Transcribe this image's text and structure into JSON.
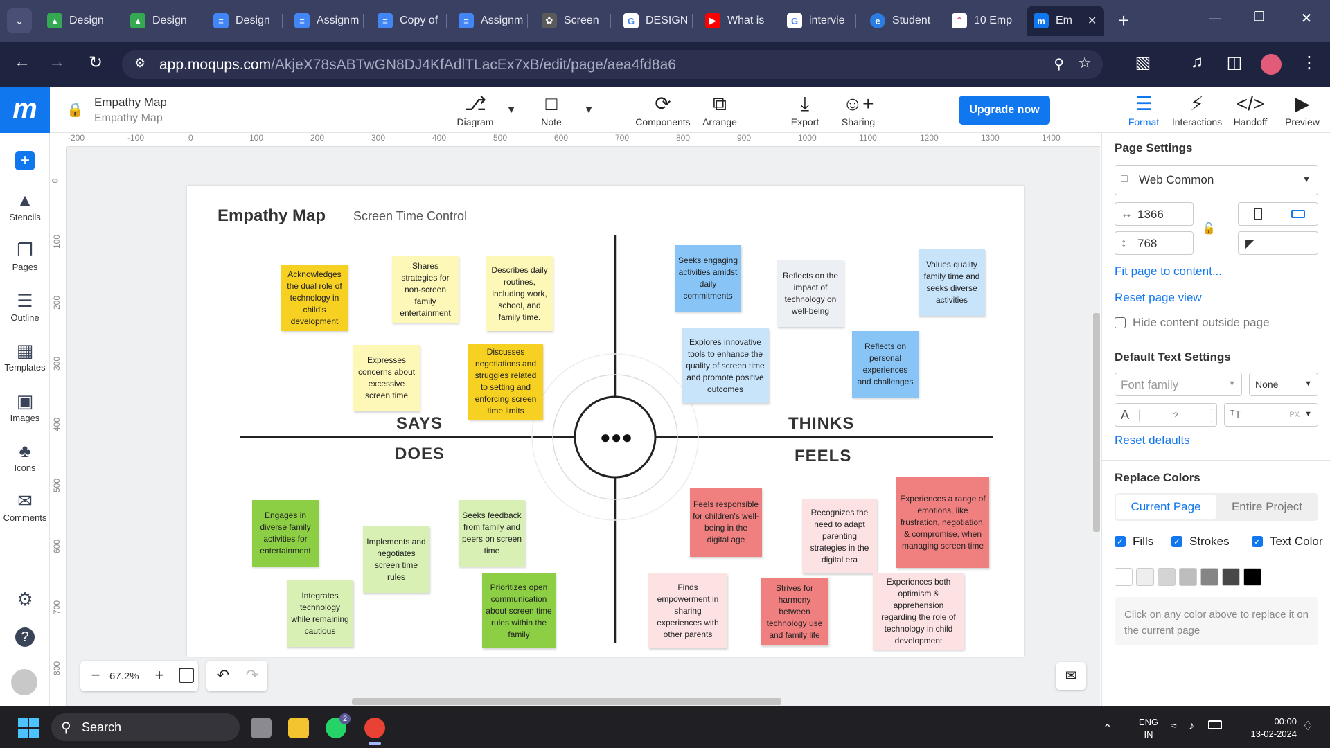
{
  "browser": {
    "tabs": [
      {
        "label": "Design",
        "icon": "google-drive-icon",
        "color": "#34a853"
      },
      {
        "label": "Design",
        "icon": "google-drive-icon",
        "color": "#34a853"
      },
      {
        "label": "Design",
        "icon": "google-docs-icon",
        "color": "#4285f4"
      },
      {
        "label": "Assignm",
        "icon": "google-docs-icon",
        "color": "#4285f4"
      },
      {
        "label": "Copy of",
        "icon": "google-docs-icon",
        "color": "#4285f4"
      },
      {
        "label": "Assignm",
        "icon": "google-docs-icon",
        "color": "#4285f4"
      },
      {
        "label": "Screen",
        "icon": "chatgpt-icon",
        "color": "#5a5a5a"
      },
      {
        "label": "DESIGN",
        "icon": "google-icon",
        "color": "#ffffff"
      },
      {
        "label": "What is",
        "icon": "youtube-icon",
        "color": "#ff0000"
      },
      {
        "label": "intervie",
        "icon": "google-icon",
        "color": "#ffffff"
      },
      {
        "label": "Student",
        "icon": "edge-icon",
        "color": "#2a7de1"
      },
      {
        "label": "10 Emp",
        "icon": "clickup-icon",
        "color": "#e84393"
      },
      {
        "label": "Em",
        "icon": "moqups-icon",
        "color": "#1177ee"
      }
    ],
    "url_domain": "app.moqups.com",
    "url_path": "/AkjeX78sABTwGN8DJ4KfAdlTLacEx7xB/edit/page/aea4fd8a6"
  },
  "app": {
    "logo": "m",
    "doc_title": "Empathy Map",
    "doc_subtitle": "Empathy Map",
    "toolbar": {
      "diagram": "Diagram",
      "note": "Note",
      "components": "Components",
      "arrange": "Arrange",
      "export": "Export",
      "sharing": "Sharing",
      "upgrade": "Upgrade now",
      "format": "Format",
      "interactions": "Interactions",
      "handoff": "Handoff",
      "preview": "Preview"
    },
    "sidebar": [
      "Stencils",
      "Pages",
      "Outline",
      "Templates",
      "Images",
      "Icons",
      "Comments"
    ],
    "ruler_top": [
      "-200",
      "-100",
      "0",
      "100",
      "200",
      "300",
      "400",
      "500",
      "600",
      "700",
      "800",
      "900",
      "1000",
      "1100",
      "1200",
      "1300",
      "1400"
    ],
    "ruler_left": [
      "0",
      "100",
      "200",
      "300",
      "400",
      "500",
      "600",
      "700",
      "800"
    ],
    "zoom": "67.2%"
  },
  "map": {
    "title": "Empathy Map",
    "subtitle": "Screen Time Control",
    "labels": {
      "says": "SAYS",
      "thinks": "THINKS",
      "does": "DOES",
      "feels": "FEELS"
    },
    "notes": [
      "Acknowledges the dual role of technology in child's development",
      "Shares strategies for non-screen family entertainment",
      "Describes daily routines, including work, school, and family time.",
      "Expresses concerns about excessive screen time",
      "Discusses negotiations and struggles related to setting and enforcing screen time limits",
      "Seeks engaging activities amidst daily commitments",
      "Reflects on the impact of technology on well-being",
      "Values quality family time and seeks diverse activities",
      "Explores innovative tools to enhance the quality of screen time and promote positive outcomes",
      "Reflects on personal experiences and challenges",
      "Engages in diverse family activities for entertainment",
      "Implements and negotiates screen time rules",
      "Seeks feedback from family and peers on screen time",
      "Integrates technology while remaining cautious",
      "Prioritizes open communication about screen time rules within the family",
      "Feels responsible for children's well-being in the digital age",
      "Recognizes the need to adapt parenting strategies in the digital era",
      "Experiences a range of emotions, like frustration, negotiation, & compromise, when managing screen time",
      "Finds empowerment in sharing experiences with other parents",
      "Strives for harmony between technology use and family life",
      "Experiences both optimism & apprehension regarding the role of technology in child development"
    ]
  },
  "panel": {
    "page_settings": "Page Settings",
    "preset": "Web Common",
    "width": "1366",
    "height": "768",
    "fit": "Fit page to content...",
    "reset_view": "Reset page view",
    "hide_outside": "Hide content outside page",
    "text_settings": "Default Text Settings",
    "font_family": "Font family",
    "none": "None",
    "font_size": "?",
    "px": "PX",
    "reset_defaults": "Reset defaults",
    "replace_colors": "Replace Colors",
    "current_page": "Current Page",
    "entire_project": "Entire Project",
    "fills": "Fills",
    "strokes": "Strokes",
    "text_color": "Text Color",
    "swatches": [
      "#ffffff",
      "#eeeeee",
      "#d4d4d4",
      "#bdbdbd",
      "#858585",
      "#484848",
      "#000000"
    ],
    "hint": "Click on any color above to replace it on the current page"
  },
  "taskbar": {
    "search": "Search",
    "lang1": "ENG",
    "lang2": "IN",
    "time": "00:00",
    "date": "13-02-2024",
    "badge": "2"
  }
}
